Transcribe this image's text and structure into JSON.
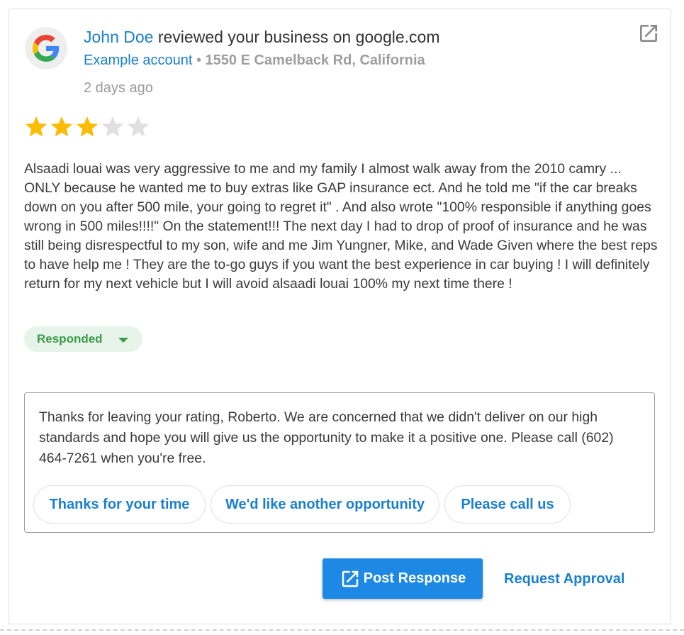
{
  "review": {
    "reviewer_name": "John Doe",
    "header_suffix": " reviewed your business on google.com",
    "account_name": "Example account",
    "separator": " • ",
    "address": "1550 E Camelback Rd, California",
    "time_ago": "2 days ago",
    "rating": 3,
    "max_rating": 5,
    "text": "Alsaadi louai was very aggressive to me and my family I almost walk away from the 2010 camry ... ONLY because he wanted me to buy extras like GAP insurance ect. And he told me \"if the car breaks down on you after 500 mile, your going to regret it\" . And also wrote \"100% responsible if anything goes wrong in 500 miles!!!!\" On the statement!!! The next day I had to drop of proof of insurance and he was still being disrespectful to my son, wife and me Jim Yungner, Mike, and Wade Given where the best reps to have help me ! They are the to-go guys if you want the best experience in car buying ! I will definitely return for my next vehicle but I will avoid alsaadi louai 100% my next time there !",
    "status_label": "Responded"
  },
  "response": {
    "text": "Thanks for leaving your rating, Roberto. We are concerned that we didn't deliver on our high standards and hope you will give us the opportunity to make it a positive one. Please call (602) 464-7261 when you're free.",
    "suggestions": [
      "Thanks for your time",
      "We'd like another opportunity",
      "Please call us"
    ]
  },
  "actions": {
    "post_label": "Post Response",
    "request_label": "Request Approval"
  },
  "colors": {
    "link_blue": "#1b7fd1",
    "button_blue": "#1e88e5",
    "star_filled": "#fbbc04",
    "star_empty": "#e0e0e0",
    "responded_bg": "#e6f4ea",
    "responded_text": "#3d9b4a"
  },
  "icons": {
    "avatar": "google-logo-icon",
    "external": "open-in-new-icon",
    "post": "edit-square-icon"
  }
}
